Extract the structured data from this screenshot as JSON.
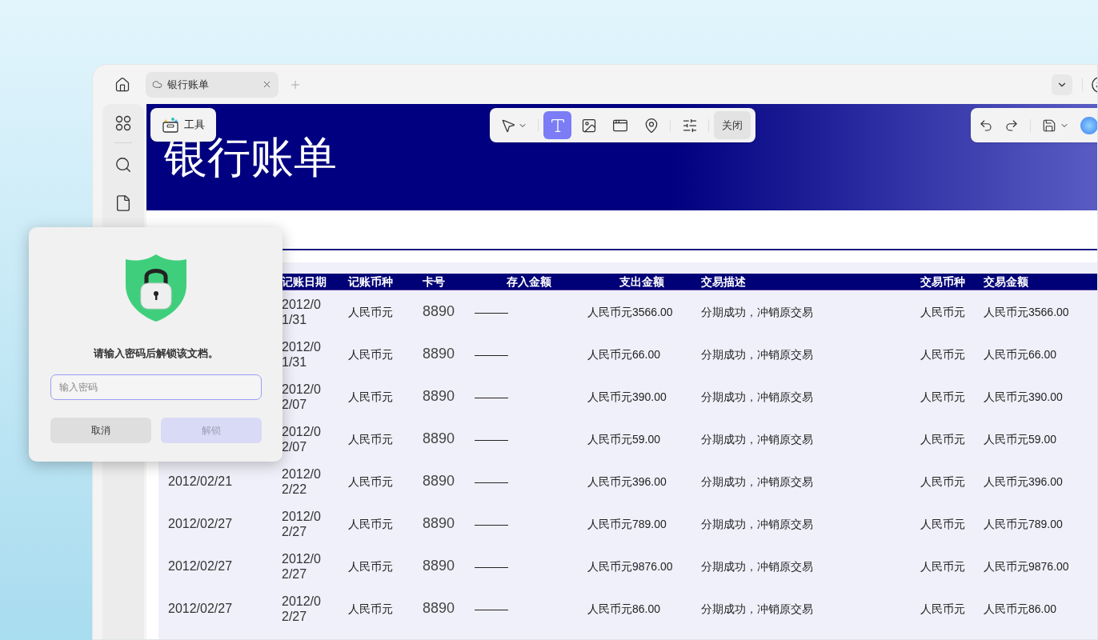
{
  "tab": {
    "title": "银行账单",
    "selected": true
  },
  "tools_button": "工具",
  "toolbar": {
    "tools": [
      {
        "kind": "select",
        "selected": false
      },
      {
        "kind": "text",
        "selected": true
      },
      {
        "kind": "image",
        "selected": false
      },
      {
        "kind": "link",
        "selected": false
      },
      {
        "kind": "location",
        "selected": false
      },
      {
        "kind": "adjust",
        "selected": false
      }
    ],
    "close": "关闭"
  },
  "document": {
    "title": "银行账单",
    "columns": [
      "记账日期",
      "记账币种",
      "卡号",
      "存入金额",
      "支出金额",
      "交易描述",
      "交易币种",
      "交易金额"
    ],
    "rows": [
      {
        "post_date": "2012/01/31",
        "currency": "人民币元",
        "card": "8890",
        "deposit": "———",
        "withdrawal": "人民币元3566.00",
        "description": "分期成功，冲销原交易",
        "txn_currency": "人民币元",
        "txn_amount": "人民币元3566.00"
      },
      {
        "post_date": "2012/01/31",
        "currency": "人民币元",
        "card": "8890",
        "deposit": "———",
        "withdrawal": "人民币元66.00",
        "description": "分期成功，冲销原交易",
        "txn_currency": "人民币元",
        "txn_amount": "人民币元66.00"
      },
      {
        "post_date": "2012/02/07",
        "currency": "人民币元",
        "card": "8890",
        "deposit": "———",
        "withdrawal": "人民币元390.00",
        "description": "分期成功，冲销原交易",
        "txn_currency": "人民币元",
        "txn_amount": "人民币元390.00"
      },
      {
        "post_date": "2012/02/07",
        "currency": "人民币元",
        "card": "8890",
        "deposit": "———",
        "withdrawal": "人民币元59.00",
        "description": "分期成功，冲销原交易",
        "txn_currency": "人民币元",
        "txn_amount": "人民币元59.00"
      },
      {
        "txn_date": "2012/02/21",
        "post_date": "2012/02/22",
        "currency": "人民币元",
        "card": "8890",
        "deposit": "———",
        "withdrawal": "人民币元396.00",
        "description": "分期成功，冲销原交易",
        "txn_currency": "人民币元",
        "txn_amount": "人民币元396.00"
      },
      {
        "txn_date": "2012/02/27",
        "post_date": "2012/02/27",
        "currency": "人民币元",
        "card": "8890",
        "deposit": "———",
        "withdrawal": "人民币元789.00",
        "description": "分期成功，冲销原交易",
        "txn_currency": "人民币元",
        "txn_amount": "人民币元789.00"
      },
      {
        "txn_date": "2012/02/27",
        "post_date": "2012/02/27",
        "currency": "人民币元",
        "card": "8890",
        "deposit": "———",
        "withdrawal": "人民币元9876.00",
        "description": "分期成功，冲销原交易",
        "txn_currency": "人民币元",
        "txn_amount": "人民币元9876.00"
      },
      {
        "txn_date": "2012/02/27",
        "post_date": "2012/02/27",
        "currency": "人民币元",
        "card": "8890",
        "deposit": "———",
        "withdrawal": "人民币元86.00",
        "description": "分期成功，冲销原交易",
        "txn_currency": "人民币元",
        "txn_amount": "人民币元86.00"
      }
    ]
  },
  "dialog": {
    "message": "请输入密码后解锁该文档。",
    "password": {
      "placeholder": "输入密码"
    },
    "cancel": "取消",
    "unlock": {
      "label": "解锁",
      "disabled": true
    }
  }
}
